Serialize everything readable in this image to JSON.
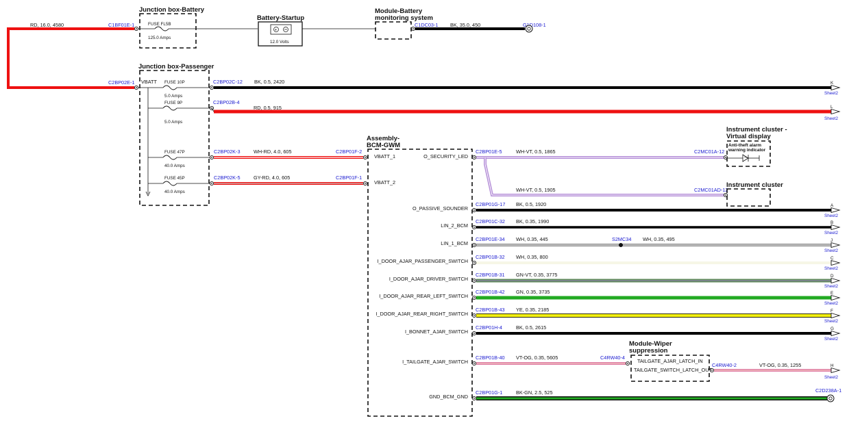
{
  "components": {
    "jb_battery": "Junction box-Battery",
    "battery_startup": "Battery-Startup",
    "module_battery_1": "Module-Battery",
    "module_battery_2": "monitoring system",
    "jb_passenger": "Junction box-Passenger",
    "bcm_1": "Assembly-",
    "bcm_2": "BCM-GWM",
    "ic_virtual_1": "Instrument cluster -",
    "ic_virtual_2": "Virtual display",
    "ic_virtual_note_1": "Anti-theft alarm",
    "ic_virtual_note_2": "warning indicator",
    "ic": "Instrument cluster",
    "wiper_1": "Module-Wiper",
    "wiper_2": "suppression"
  },
  "fuses": {
    "fl5b": "FUSE FL5B",
    "fl5b_amps": "125.0 Amps",
    "f10p": "FUSE 10P",
    "f10p_amps": "5.0 Amps",
    "f9p": "FUSE 9P",
    "f9p_amps": "5.0 Amps",
    "f47p": "FUSE 47P",
    "f47p_amps": "40.0 Amps",
    "f45p": "FUSE 45P",
    "f45p_amps": "40.0 Amps",
    "battery_volts": "12.0 Volts"
  },
  "pins": {
    "vbatt": "VBATT",
    "vbatt_1": "VBATT_1",
    "vbatt_2": "VBATT_2",
    "o_security_led": "O_SECURITY_LED",
    "o_passive_sounder": "O_PASSIVE_SOUNDER",
    "lin_2_bcm": "LIN_2_BCM",
    "lin_1_bcm": "LIN_1_BCM",
    "door_pass": "I_DOOR_AJAR_PASSENGER_SWITCH",
    "door_driver": "I_DOOR_AJAR_DRIVER_SWITCH",
    "door_rear_left": "I_DOOR_AJAR_REAR_LEFT_SWITCH",
    "door_rear_right": "I_DOOR_AJAR_REAR_RIGHT_SWITCH",
    "bonnet": "I_BONNET_AJAR_SWITCH",
    "tailgate": "I_TAILGATE_AJAR_SWITCH",
    "gnd": "GND_BCM_GND",
    "wiper_in": "TAILGATE_AJAR_LATCH_IN",
    "wiper_out": "TAILGATE_SWITCH_LATCH_OUT"
  },
  "connectors": {
    "c1bf01e_1": "C1BF01E-1",
    "c1dc03_1": "C1DC03-1",
    "g1d108_1": "G1D108-1",
    "c2bp02e_1": "C2BP02E-1",
    "c2bp02c_12": "C2BP02C-12",
    "c2bp02b_4": "C2BP02B-4",
    "c2bp02k_3": "C2BP02K-3",
    "c2bp01f_2": "C2BP01F-2",
    "c2bp02k_5": "C2BP02K-5",
    "c2bp01f_1": "C2BP01F-1",
    "c2bp01e_5": "C2BP01E-5",
    "c2mc01a_12": "C2MC01A-12",
    "c2mc01ad_12": "C2MC01AD-12",
    "c2bp01g_17": "C2BP01G-17",
    "c2bp01c_32": "C2BP01C-32",
    "c2bp01e_34": "C2BP01E-34",
    "s2mc34": "S2MC34",
    "c2bp01b_32": "C2BP01B-32",
    "c2bp01b_31": "C2BP01B-31",
    "c2bp01b_42": "C2BP01B-42",
    "c2bp01b_43": "C2BP01B-43",
    "c2bp01h_4": "C2BP01H-4",
    "c2bp01b_40": "C2BP01B-40",
    "c4rw40_4": "C4RW40-4",
    "c4rw40_2": "C4RW40-2",
    "c2bp01g_1": "C2BP01G-1",
    "c2d238a_1": "C2D238A-1"
  },
  "wires": {
    "battery_main": "RD,  16.0,  4580",
    "battery_ground": "BK,  35.0,  450",
    "k": "BK,  0.5,  2420",
    "l": "RD,  0.5,  915",
    "f47": "WH-RD,  4.0,  605",
    "f45": "GY-RD,  4.0,  605",
    "sec_1": "WH-VT,  0.5,  1865",
    "sec_2": "WH-VT,  0.5,  1905",
    "a": "BK,  0.5,  1920",
    "b": "BK,  0.35,  1990",
    "j1": "WH,  0.35,  445",
    "j2": "WH,  0.35,  495",
    "c": "WH,  0.35,  800",
    "d": "GN-VT,  0.35,  3775",
    "e": "GN,  0.35,  3735",
    "f": "YE,  0.35,  2185",
    "g": "BK,  0.5,  2615",
    "h1": "VT-OG,  0.35,  5605",
    "h2": "VT-OG,  0.35,  1255",
    "gnd": "BK-GN,  2.5,  525"
  },
  "sheet_refs": {
    "k": "K",
    "l": "L",
    "a": "A",
    "b": "B",
    "j": "J",
    "c": "C",
    "d": "D",
    "e": "E",
    "f": "F",
    "g": "G",
    "h": "H",
    "sheet": "Sheet2"
  },
  "colors": {
    "red": "#ee1111",
    "black": "#000000",
    "violet": "#b58fd8",
    "green_violet": "#5f8a5a",
    "green": "#22aa22",
    "yellow": "#f2ef10",
    "pink": "#e07fa8",
    "white_wire": "#f6f6e6",
    "connector_blue": "#1a1ad0"
  }
}
